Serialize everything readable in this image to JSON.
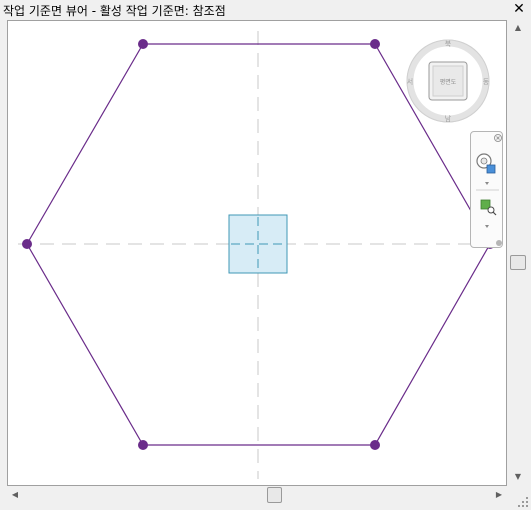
{
  "window": {
    "title": "작업 기준면 뷰어 - 활성 작업 기준면: 참조점",
    "close_icon": "close-icon"
  },
  "viewcube": {
    "face_label": "평면도",
    "compass_labels": [
      "북",
      "동",
      "남",
      "서"
    ]
  },
  "navigation_bar": {
    "close_icon": "close-icon",
    "tools": [
      "full-navigation-wheel-icon",
      "zoom-region-icon"
    ],
    "menu_icon": "chevron-down-icon"
  },
  "scrollbars": {
    "vertical_thumb_fraction": 0.5,
    "horizontal_thumb_fraction": 0.5
  },
  "colors": {
    "shape_stroke": "#6a2c8a",
    "vertex_fill": "#6a2c8a",
    "reference_point_fill": "#d7ecf6",
    "reference_point_stroke": "#3f97b5",
    "center_line": "#c8c8c8"
  }
}
